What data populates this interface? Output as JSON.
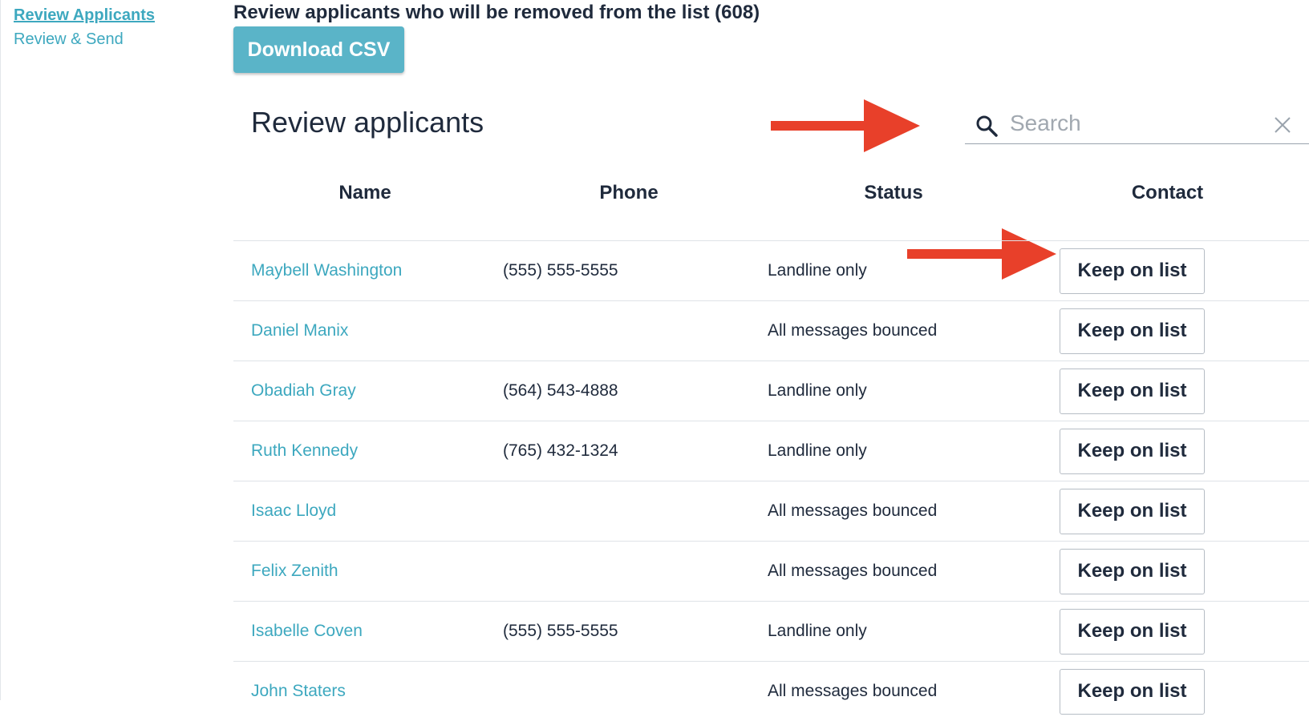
{
  "sidebar": {
    "items": [
      {
        "label": "Review Applicants",
        "active": true
      },
      {
        "label": "Review & Send",
        "active": false
      }
    ]
  },
  "main": {
    "heading": "Review applicants who will be removed from the list (608)",
    "download_label": "Download CSV",
    "card_title": "Review applicants",
    "search": {
      "placeholder": "Search",
      "value": ""
    },
    "columns": [
      "Name",
      "Phone",
      "Status",
      "Contact"
    ],
    "rows": [
      {
        "name": "Maybell Washington",
        "phone": "(555) 555-5555",
        "status": "Landline only",
        "action": "Keep on list"
      },
      {
        "name": "Daniel Manix",
        "phone": "",
        "status": "All messages bounced",
        "action": "Keep on list"
      },
      {
        "name": "Obadiah Gray",
        "phone": "(564) 543-4888",
        "status": "Landline only",
        "action": "Keep on list"
      },
      {
        "name": "Ruth Kennedy",
        "phone": "(765) 432-1324",
        "status": "Landline only",
        "action": "Keep on list"
      },
      {
        "name": "Isaac Lloyd",
        "phone": "",
        "status": "All messages bounced",
        "action": "Keep on list"
      },
      {
        "name": "Felix Zenith",
        "phone": "",
        "status": "All messages bounced",
        "action": "Keep on list"
      },
      {
        "name": "Isabelle Coven",
        "phone": "(555) 555-5555",
        "status": "Landline only",
        "action": "Keep on list"
      },
      {
        "name": "John Staters",
        "phone": "",
        "status": "All messages bounced",
        "action": "Keep on list"
      }
    ]
  },
  "icons": {
    "search": "search-icon",
    "clear": "close-icon",
    "annotation": "arrow-right-icon"
  },
  "colors": {
    "accent": "#3da8bf",
    "button": "#5ab4c8",
    "arrow": "#e8402a",
    "text": "#1f2a3c"
  }
}
